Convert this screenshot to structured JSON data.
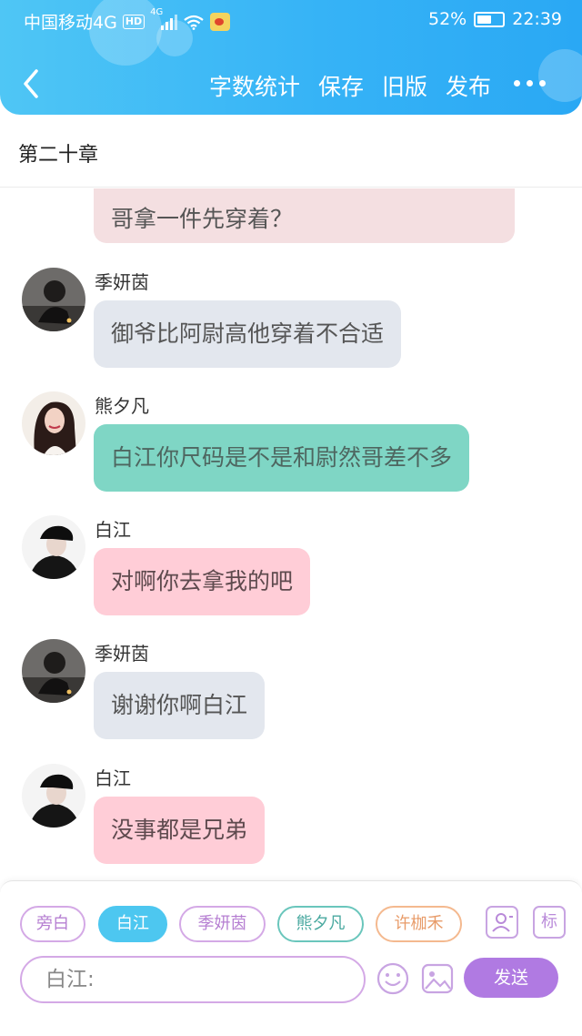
{
  "status_bar": {
    "carrier": "中国移动4G",
    "hd": "HD",
    "network": "4G",
    "battery": "52%",
    "time": "22:39"
  },
  "header": {
    "actions": [
      "字数统计",
      "保存",
      "旧版",
      "发布"
    ],
    "more_icon": "more-horizontal-icon",
    "back_icon": "chevron-left-icon",
    "bg_color": "#36b3f6"
  },
  "chapter": {
    "title": "第二十章"
  },
  "messages": [
    {
      "name": "季妍茵",
      "text": "御爷比阿尉高他穿着不合适",
      "style": "gray"
    },
    {
      "name": "熊夕凡",
      "text": "白江你尺码是不是和尉然哥差不多",
      "style": "teal"
    },
    {
      "name": "白江",
      "text": "对啊你去拿我的吧",
      "style": "pink"
    },
    {
      "name": "季妍茵",
      "text": "谢谢你啊白江",
      "style": "gray"
    },
    {
      "name": "白江",
      "text": "没事都是兄弟",
      "style": "pink"
    }
  ],
  "partial_message": {
    "text": "哥拿一件先穿着？"
  },
  "composer": {
    "characters": [
      "旁白",
      "白江",
      "季妍茵",
      "熊夕凡",
      "许枷禾"
    ],
    "active_character": "白江",
    "mark_label": "标",
    "input_value": "白江:",
    "send_label": "发送",
    "accent_color": "#b07ae2"
  }
}
